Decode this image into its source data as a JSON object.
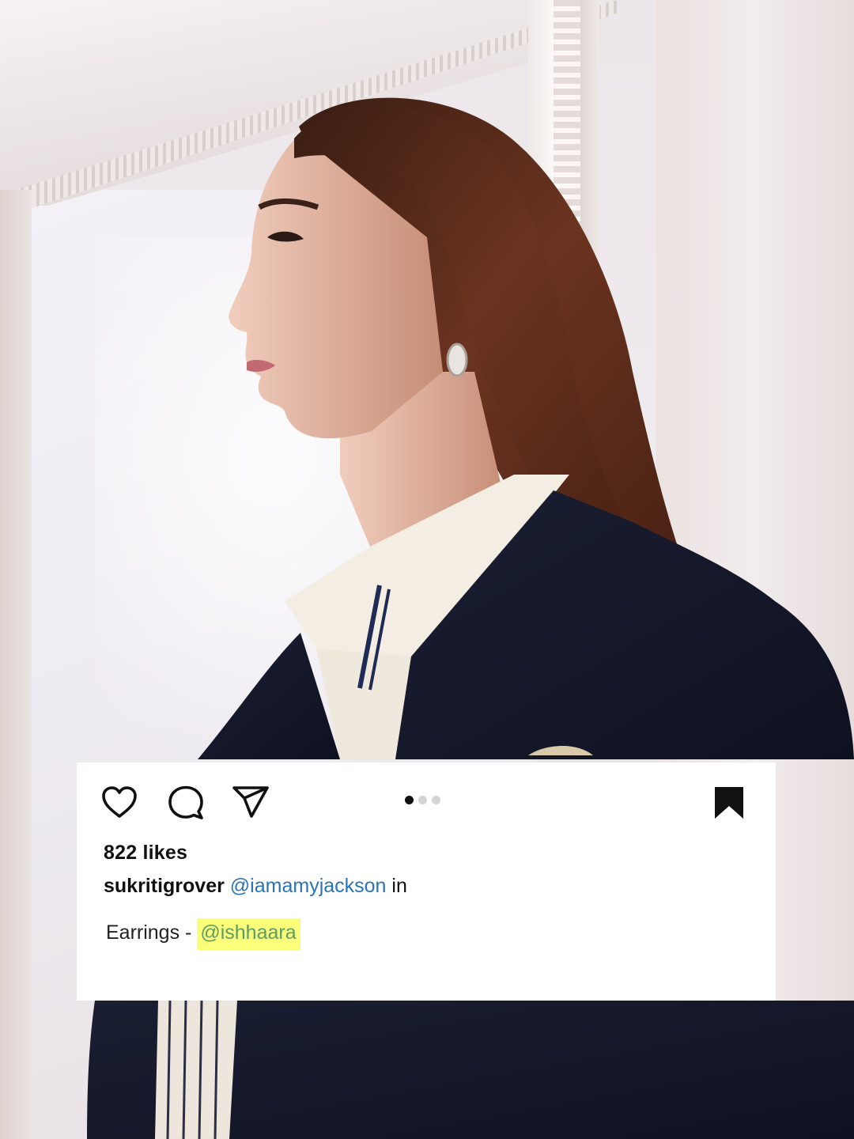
{
  "post": {
    "likes": "822 likes",
    "username": "sukritigrover",
    "mention": "@iamamyjackson",
    "after_mention": "in",
    "detail_label": "Earrings -",
    "detail_tag": "@ishhaara",
    "carousel": {
      "total": 3,
      "active_index": 0
    }
  },
  "icons": {
    "like": "heart-icon",
    "comment": "comment-icon",
    "share": "send-icon",
    "save": "bookmark-icon"
  },
  "colors": {
    "mention": "#2b74b3",
    "highlight": "#fafe78",
    "highlight_text": "#5f9c68",
    "card_bg": "#ffffff"
  }
}
